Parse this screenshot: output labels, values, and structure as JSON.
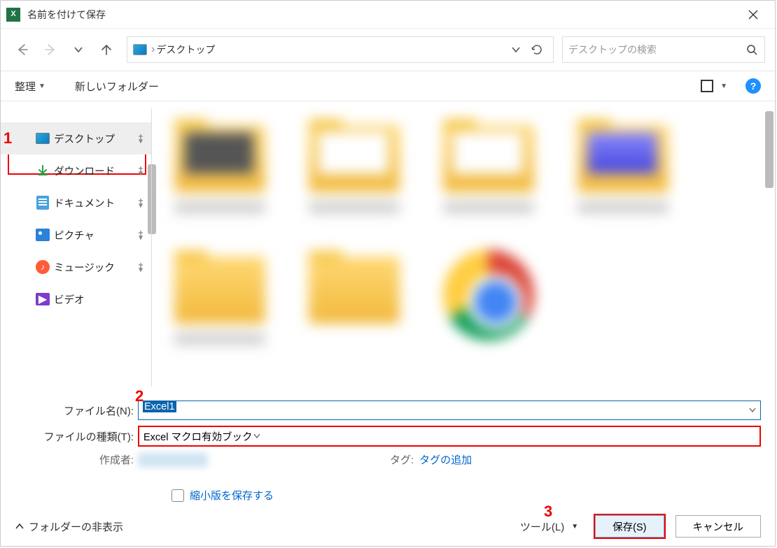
{
  "title": "名前を付けて保存",
  "address": {
    "location": "デスクトップ"
  },
  "search": {
    "placeholder": "デスクトップの検索"
  },
  "toolbar": {
    "organize": "整理",
    "new_folder": "新しいフォルダー"
  },
  "sidebar": {
    "items": [
      {
        "label": "デスクトップ"
      },
      {
        "label": "ダウンロード"
      },
      {
        "label": "ドキュメント"
      },
      {
        "label": "ピクチャ"
      },
      {
        "label": "ミュージック"
      },
      {
        "label": "ビデオ"
      }
    ]
  },
  "fields": {
    "filename_label": "ファイル名(N):",
    "filename_value": "Excel1",
    "filetype_label": "ファイルの種類(T):",
    "filetype_value": "Excel マクロ有効ブック",
    "author_label": "作成者:",
    "tag_label": "タグ:",
    "tag_add": "タグの追加",
    "thumbnail_checkbox": "縮小版を保存する"
  },
  "footer": {
    "hide_folders": "フォルダーの非表示",
    "tools": "ツール(L)",
    "save": "保存(S)",
    "cancel": "キャンセル"
  },
  "annotations": {
    "a1": "1",
    "a2": "2",
    "a3": "3"
  }
}
